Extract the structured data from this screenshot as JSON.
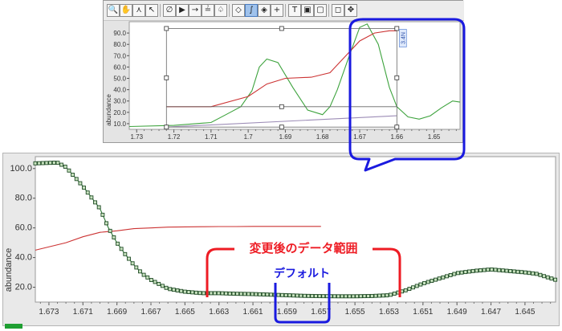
{
  "toolbar": {
    "tools": [
      {
        "icon": "zoom-icon",
        "glyph": "🔍"
      },
      {
        "icon": "pan-hand-icon",
        "glyph": "✋"
      },
      {
        "icon": "peak-pick-icon",
        "glyph": "⋏"
      },
      {
        "icon": "cursor-select-icon",
        "glyph": "↖"
      },
      {
        "icon": "slash-icon",
        "glyph": "∅"
      },
      {
        "icon": "play-arrow-icon",
        "glyph": "▶"
      },
      {
        "icon": "arrow-right-icon",
        "glyph": "→"
      },
      {
        "icon": "baseline-icon",
        "glyph": "≟"
      },
      {
        "icon": "tree-icon",
        "glyph": "♤"
      },
      {
        "icon": "diamond-icon",
        "glyph": "◇"
      },
      {
        "icon": "integral-icon",
        "glyph": "∫"
      },
      {
        "icon": "eraser-icon",
        "glyph": "◈"
      },
      {
        "icon": "crosshair-icon",
        "glyph": "+"
      },
      {
        "icon": "text-tool-icon",
        "glyph": "T"
      },
      {
        "icon": "image-box-icon",
        "glyph": "▣"
      },
      {
        "icon": "square-box-icon",
        "glyph": "▢"
      },
      {
        "icon": "frame-icon",
        "glyph": "◻"
      },
      {
        "icon": "move-icon",
        "glyph": "✥"
      }
    ]
  },
  "top_chart": {
    "ylabel": "abundance",
    "integral_label": "3.4N",
    "chart_data": {
      "type": "line",
      "xlabel": "",
      "ylabel": "abundance",
      "x_reversed": true,
      "xlim": [
        1.732,
        1.643
      ],
      "ylim": [
        5,
        100
      ],
      "xticks": [
        "1.73",
        "1.72",
        "1.71",
        "1.7",
        "1.69",
        "1.68",
        "1.67",
        "1.66",
        "1.65"
      ],
      "yticks": [
        "10.0",
        "20.0",
        "30.0",
        "40.0",
        "50.0",
        "60.0",
        "70.0",
        "80.0",
        "90.0"
      ],
      "series": [
        {
          "name": "",
          "color": "#3ea33e",
          "x": [
            1.732,
            1.72,
            1.71,
            1.706,
            1.702,
            1.699,
            1.697,
            1.695,
            1.692,
            1.688,
            1.684,
            1.68,
            1.678,
            1.676,
            1.673,
            1.67,
            1.668,
            1.665,
            1.662,
            1.66,
            1.657,
            1.654,
            1.651,
            1.648,
            1.645,
            1.643
          ],
          "y": [
            7.5,
            8.5,
            11,
            18,
            25,
            39,
            60,
            67,
            64,
            42,
            22,
            18,
            25,
            40,
            68,
            95,
            98,
            80,
            42,
            25,
            16,
            14,
            17,
            24,
            30,
            29
          ]
        },
        {
          "name": "",
          "color": "#cc3333",
          "x": [
            1.722,
            1.71,
            1.7,
            1.695,
            1.69,
            1.683,
            1.678,
            1.674,
            1.67,
            1.666,
            1.662,
            1.66
          ],
          "y": [
            25,
            25,
            34,
            45,
            50,
            51,
            55,
            69,
            83,
            90,
            92,
            92
          ]
        },
        {
          "name": "",
          "color": "#9c8cb6",
          "x": [
            1.722,
            1.66
          ],
          "y": [
            7,
            17
          ]
        }
      ]
    }
  },
  "bottom_chart": {
    "ylabel": "abundance",
    "chart_data": {
      "type": "line",
      "xlabel": "",
      "ylabel": "abundance",
      "x_reversed": true,
      "xlim": [
        1.6738,
        1.6432
      ],
      "ylim": [
        10,
        108
      ],
      "xticks": [
        "1.673",
        "1.671",
        "1.669",
        "1.667",
        "1.665",
        "1.663",
        "1.661",
        "1.659",
        "1.657",
        "1.655",
        "1.653",
        "1.651",
        "1.649",
        "1.647",
        "1.645"
      ],
      "yticks": [
        "20.0",
        "40.0",
        "60.0",
        "80.0",
        "100.0"
      ],
      "series": [
        {
          "name": "",
          "color": "#2e7a36",
          "marker": "square",
          "x": [
            1.6738,
            1.6725,
            1.672,
            1.671,
            1.67,
            1.6695,
            1.669,
            1.6685,
            1.668,
            1.6675,
            1.667,
            1.666,
            1.665,
            1.664,
            1.663,
            1.662,
            1.661,
            1.66,
            1.659,
            1.658,
            1.657,
            1.656,
            1.655,
            1.654,
            1.653,
            1.652,
            1.651,
            1.65,
            1.649,
            1.648,
            1.647,
            1.646,
            1.645,
            1.6443,
            1.6432
          ],
          "y": [
            103.5,
            104,
            101,
            88,
            73,
            60,
            50,
            42,
            35,
            29,
            25,
            19,
            17,
            16,
            16,
            15.6,
            15.4,
            15,
            14.6,
            14.2,
            14,
            13.9,
            13.9,
            14.1,
            14.6,
            18,
            22.5,
            26,
            29.5,
            31,
            32,
            31,
            30,
            29,
            25
          ]
        },
        {
          "name": "",
          "color": "#cc3333",
          "x": [
            1.6738,
            1.672,
            1.671,
            1.67,
            1.669,
            1.668,
            1.667,
            1.666,
            1.665,
            1.664,
            1.663,
            1.662,
            1.661,
            1.66,
            1.659,
            1.658,
            1.657
          ],
          "y": [
            45,
            50,
            54,
            57,
            58,
            59.5,
            60,
            60.5,
            60.7,
            60.8,
            60.9,
            60.9,
            61,
            61,
            61,
            61,
            61
          ]
        }
      ]
    }
  },
  "annotations": {
    "changed_range_label": "変更後のデータ範囲",
    "default_label": "デフォルト"
  },
  "colors": {
    "callout_blue": "#1a1adf",
    "range_red": "#ee1c24"
  }
}
